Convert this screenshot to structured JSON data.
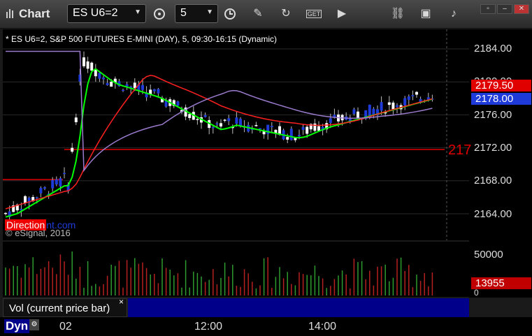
{
  "window": {
    "title": "Chart"
  },
  "toolbar": {
    "symbol": "ES U6=2",
    "interval": "5",
    "icons": [
      "clock-settings-icon",
      "time-icon",
      "draw-pencil-icon",
      "refresh-icon",
      "get-icon",
      "play-icon",
      "link-icon",
      "chat-icon",
      "twitter-icon"
    ],
    "get_text": "GET"
  },
  "chart": {
    "symbol_label": "* ES U6=2, S&P 500 FUTURES E-MINI (DAY), 5, 09:30-16:15 (Dynamic)",
    "price_ticks": [
      "2184.00",
      "2180.00",
      "2176.00",
      "2172.00",
      "2168.00",
      "2164.00"
    ],
    "price_box_red": "2179.50",
    "price_box_blue": "2178.00",
    "hline_label": "217",
    "copyright": "© eSignal, 2016",
    "logo_red": "Direction",
    "logo_blue": "nt.com",
    "colors": {
      "up": "#ffffff",
      "down": "#1e3ad8",
      "ma_fast": "#00ff00",
      "ma_slow": "#ff2020",
      "ma_purple": "#9a7acd",
      "hline": "#e00000"
    }
  },
  "volume": {
    "ticks": [
      "50000",
      "0"
    ],
    "last_box": "13955",
    "label": "Vol (current price bar)",
    "close": "×"
  },
  "timeaxis": {
    "ticks": [
      "02",
      "12:00",
      "14:00"
    ],
    "dyn_label": "Dyn"
  }
}
